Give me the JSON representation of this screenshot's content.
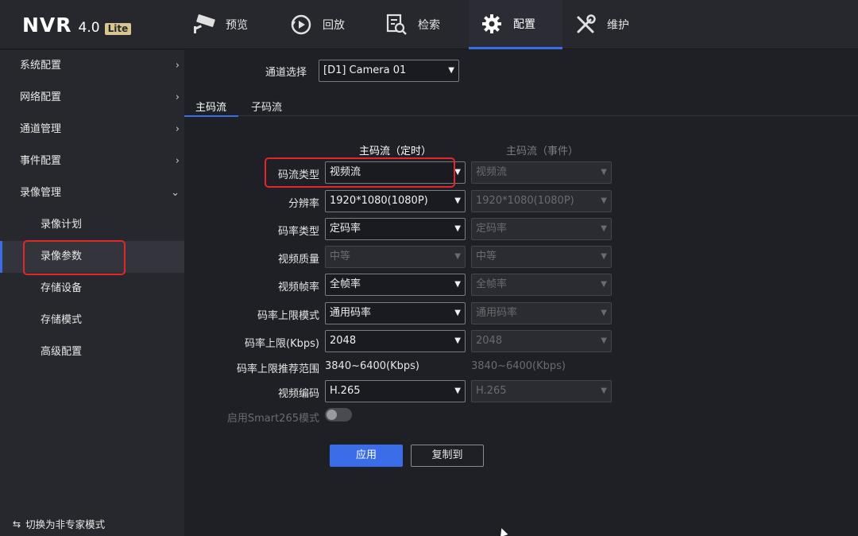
{
  "app": {
    "logo": "NVR",
    "version": "4.0",
    "edition": "Lite"
  },
  "nav": {
    "preview": "预览",
    "playback": "回放",
    "search": "检索",
    "config": "配置",
    "maintain": "维护"
  },
  "sidebar": {
    "items": [
      {
        "label": "系统配置"
      },
      {
        "label": "网络配置"
      },
      {
        "label": "通道管理"
      },
      {
        "label": "事件配置"
      },
      {
        "label": "录像管理"
      }
    ],
    "sub": [
      {
        "label": "录像计划"
      },
      {
        "label": "录像参数"
      },
      {
        "label": "存储设备"
      },
      {
        "label": "存储模式"
      },
      {
        "label": "高级配置"
      }
    ],
    "expert_mode": "切换为非专家模式"
  },
  "channel": {
    "label": "通道选择",
    "value": "[D1] Camera 01"
  },
  "tabs": {
    "main": "主码流",
    "sub": "子码流"
  },
  "columns": {
    "scheduled": "主码流（定时）",
    "event": "主码流（事件）"
  },
  "fields": {
    "stream_type": {
      "label": "码流类型",
      "scheduled": "视频流",
      "event": "视频流"
    },
    "resolution": {
      "label": "分辨率",
      "scheduled": "1920*1080(1080P)",
      "event": "1920*1080(1080P)"
    },
    "bitrate_type": {
      "label": "码率类型",
      "scheduled": "定码率",
      "event": "定码率"
    },
    "video_quality": {
      "label": "视频质量",
      "scheduled": "中等",
      "event": "中等"
    },
    "frame_rate": {
      "label": "视频帧率",
      "scheduled": "全帧率",
      "event": "全帧率"
    },
    "max_bitrate_mode": {
      "label": "码率上限模式",
      "scheduled": "通用码率",
      "event": "通用码率"
    },
    "max_bitrate": {
      "label": "码率上限(Kbps)",
      "scheduled": "2048",
      "event": "2048"
    },
    "recommended_range": {
      "label": "码率上限推荐范围",
      "scheduled": "3840~6400(Kbps)",
      "event": "3840~6400(Kbps)"
    },
    "video_codec": {
      "label": "视频编码",
      "scheduled": "H.265",
      "event": "H.265"
    },
    "smart265": {
      "label": "启用Smart265模式"
    }
  },
  "buttons": {
    "apply": "应用",
    "copy_to": "复制到"
  }
}
